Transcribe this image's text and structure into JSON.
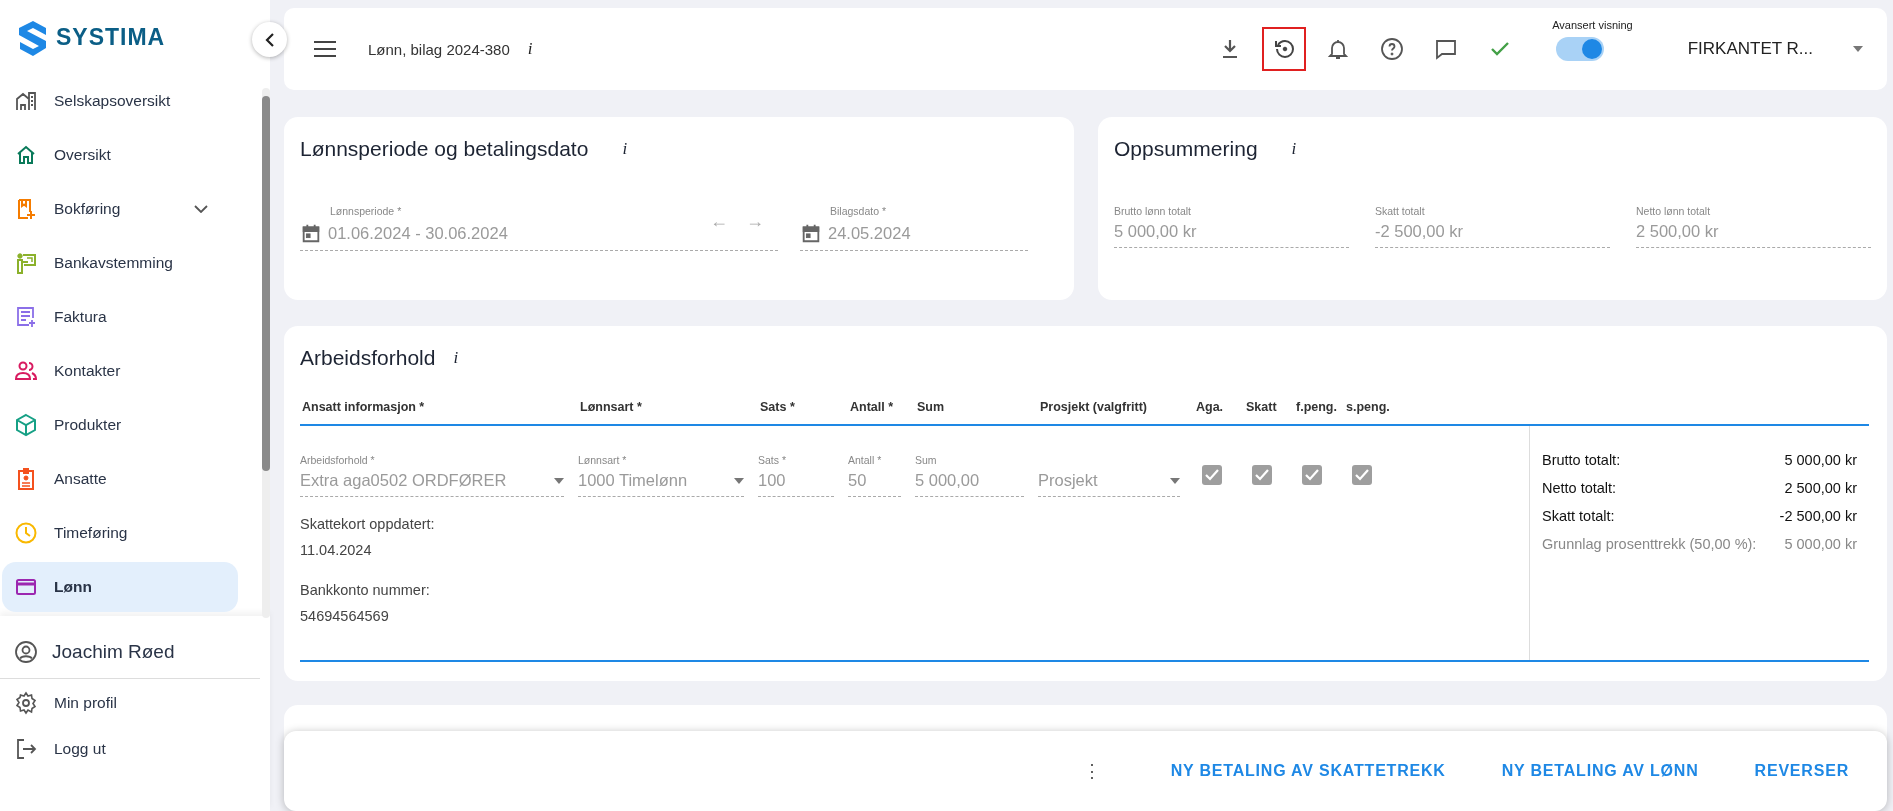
{
  "sidebar": {
    "logo": "SYSTIMA",
    "items": [
      {
        "label": "Selskapsoversikt",
        "selected": false,
        "submenu": false
      },
      {
        "label": "Oversikt",
        "selected": false,
        "submenu": false
      },
      {
        "label": "Bokføring",
        "selected": false,
        "submenu": true
      },
      {
        "label": "Bankavstemming",
        "selected": false,
        "submenu": false
      },
      {
        "label": "Faktura",
        "selected": false,
        "submenu": false
      },
      {
        "label": "Kontakter",
        "selected": false,
        "submenu": false
      },
      {
        "label": "Produkter",
        "selected": false,
        "submenu": false
      },
      {
        "label": "Ansatte",
        "selected": false,
        "submenu": false
      },
      {
        "label": "Timeføring",
        "selected": false,
        "submenu": false
      },
      {
        "label": "Lønn",
        "selected": true,
        "submenu": false
      }
    ],
    "user": "Joachim Røed",
    "footer_items": [
      {
        "label": "Min profil"
      },
      {
        "label": "Logg ut"
      }
    ]
  },
  "top_bar": {
    "title": "Lønn, bilag 2024-380",
    "info": "i",
    "tools": [
      {
        "highlighted": false
      },
      {
        "highlighted": true
      },
      {
        "highlighted": false
      },
      {
        "highlighted": false
      },
      {
        "highlighted": false
      },
      {
        "highlighted": false
      }
    ],
    "toggle": {
      "label": "Avansert visning",
      "on": true
    },
    "company": "FIRKANTET R..."
  },
  "period_card": {
    "title": "Lønnsperiode og betalingsdato",
    "info": "i",
    "period": {
      "label": "Lønnsperiode *",
      "value": "01.06.2024 - 30.06.2024"
    },
    "prev": "←",
    "next": "→",
    "voucher_date": {
      "label": "Bilagsdato *",
      "value": "24.05.2024"
    }
  },
  "summary_card": {
    "title": "Oppsummering",
    "info": "i",
    "fields": [
      {
        "label": "Brutto lønn totalt",
        "value": "5 000,00 kr"
      },
      {
        "label": "Skatt totalt",
        "value": "-2 500,00 kr"
      },
      {
        "label": "Netto lønn totalt",
        "value": "2 500,00 kr"
      }
    ]
  },
  "employment_card": {
    "title": "Arbeidsforhold",
    "info": "i",
    "columns": [
      "Ansatt informasjon *",
      "Lønnsart *",
      "Sats *",
      "Antall *",
      "Sum",
      "Prosjekt (valgfritt)",
      "Aga.",
      "Skatt",
      "f.peng.",
      "s.peng."
    ],
    "row": {
      "fields": [
        {
          "kind": "select",
          "label": "Arbeidsforhold *",
          "value": "Extra aga0502 ORDFØRER"
        },
        {
          "kind": "select",
          "label": "Lønnsart *",
          "value": "1000 Timelønn"
        },
        {
          "kind": "text",
          "label": "Sats *",
          "value": "100"
        },
        {
          "kind": "text",
          "label": "Antall *",
          "value": "50"
        },
        {
          "kind": "text",
          "label": "Sum",
          "value": "5 000,00"
        },
        {
          "kind": "select",
          "placeholder": "Prosjekt"
        }
      ],
      "checks": [
        {
          "checked": true
        },
        {
          "checked": true
        },
        {
          "checked": true
        },
        {
          "checked": true
        }
      ],
      "details": [
        {
          "label": "Skattekort oppdatert:",
          "value": "11.04.2024"
        },
        {
          "label": "Bankkonto nummer:",
          "value": "54694564569"
        }
      ]
    },
    "totals": [
      {
        "label": "Brutto totalt:",
        "value": "5 000,00 kr",
        "muted": false
      },
      {
        "label": "Netto totalt:",
        "value": "2 500,00 kr",
        "muted": false
      },
      {
        "label": "Skatt totalt:",
        "value": "-2 500,00 kr",
        "muted": false
      },
      {
        "label": "Grunnlag prosenttrekk (50,00 %):",
        "value": "5 000,00 kr",
        "muted": true
      }
    ]
  },
  "action_bar": {
    "more": "⋮",
    "buttons": [
      "NY BETALING AV SKATTETREKK",
      "NY BETALING AV LØNN",
      "REVERSER"
    ]
  }
}
